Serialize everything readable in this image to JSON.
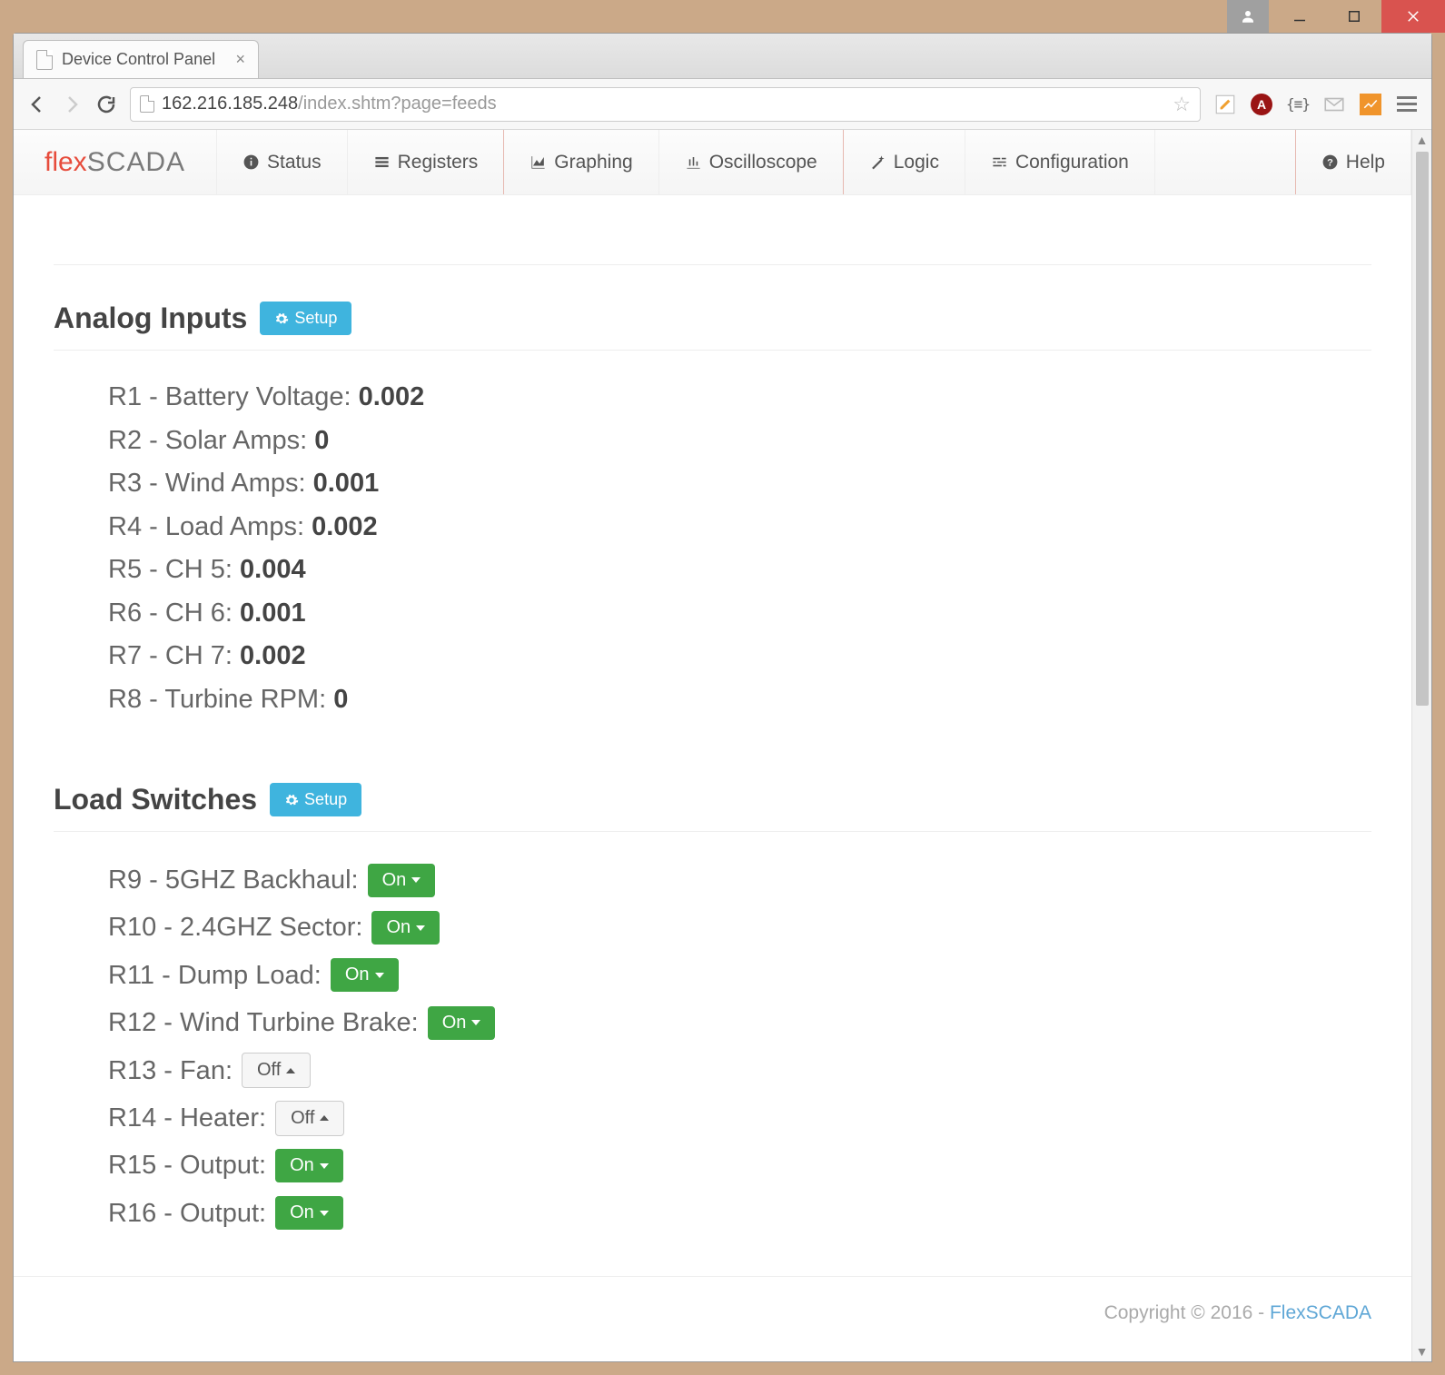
{
  "browser": {
    "tab_title": "Device Control Panel",
    "url_display_host": "162.216.185.248",
    "url_display_path": "/index.shtm?page=feeds"
  },
  "brand": {
    "part1": "flex",
    "part2": "SCADA"
  },
  "nav": {
    "status": "Status",
    "registers": "Registers",
    "graphing": "Graphing",
    "oscilloscope": "Oscilloscope",
    "logic": "Logic",
    "configuration": "Configuration",
    "help": "Help"
  },
  "sections": {
    "analog_inputs": {
      "title": "Analog Inputs",
      "setup": "Setup",
      "rows": [
        {
          "reg": "R1",
          "name": "Battery Voltage",
          "value": "0.002"
        },
        {
          "reg": "R2",
          "name": "Solar Amps",
          "value": "0"
        },
        {
          "reg": "R3",
          "name": "Wind Amps",
          "value": "0.001"
        },
        {
          "reg": "R4",
          "name": "Load Amps",
          "value": "0.002"
        },
        {
          "reg": "R5",
          "name": "CH 5",
          "value": "0.004"
        },
        {
          "reg": "R6",
          "name": "CH 6",
          "value": "0.001"
        },
        {
          "reg": "R7",
          "name": "CH 7",
          "value": "0.002"
        },
        {
          "reg": "R8",
          "name": "Turbine RPM",
          "value": "0"
        }
      ]
    },
    "load_switches": {
      "title": "Load Switches",
      "setup": "Setup",
      "on_label": "On",
      "off_label": "Off",
      "rows": [
        {
          "reg": "R9",
          "name": "5GHZ Backhaul",
          "state": "on"
        },
        {
          "reg": "R10",
          "name": "2.4GHZ Sector",
          "state": "on"
        },
        {
          "reg": "R11",
          "name": "Dump Load",
          "state": "on"
        },
        {
          "reg": "R12",
          "name": "Wind Turbine Brake",
          "state": "on"
        },
        {
          "reg": "R13",
          "name": "Fan",
          "state": "off"
        },
        {
          "reg": "R14",
          "name": "Heater",
          "state": "off"
        },
        {
          "reg": "R15",
          "name": "Output",
          "state": "on"
        },
        {
          "reg": "R16",
          "name": "Output",
          "state": "on"
        }
      ]
    }
  },
  "footer": {
    "copyright": "Copyright © 2016 - ",
    "link_text": "FlexSCADA"
  }
}
